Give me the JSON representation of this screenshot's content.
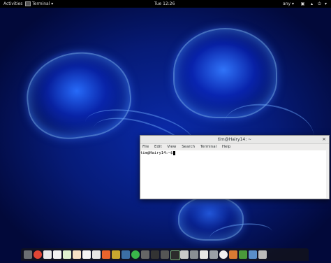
{
  "topbar": {
    "activities": "Activities",
    "app_menu": "Terminal",
    "app_menu_arrow": "▾",
    "clock": "Tue 12:26",
    "input_source": "any",
    "input_source_arrow": "▾",
    "system_arrow": "▾"
  },
  "terminal": {
    "title": "tim@Hairy14: ~",
    "close_glyph": "×",
    "menu": [
      "File",
      "Edit",
      "View",
      "Search",
      "Terminal",
      "Help"
    ],
    "prompt": "tim@Hairy14:~$"
  },
  "dock": {
    "icons": [
      "files",
      "chrome",
      "documents",
      "document",
      "spreadsheet",
      "presentation",
      "text-editor",
      "notes",
      "app-store",
      "python",
      "python",
      "spotify",
      "network",
      "settings",
      "tools",
      "terminal",
      "calculator",
      "disks",
      "printer",
      "camera",
      "clock",
      "photos",
      "app",
      "weather",
      "trash"
    ]
  },
  "colors": {
    "desktop_blue": "#0a2aa8",
    "topbar_bg": "#000000",
    "terminal_titlebar": "#e8e8e7"
  }
}
